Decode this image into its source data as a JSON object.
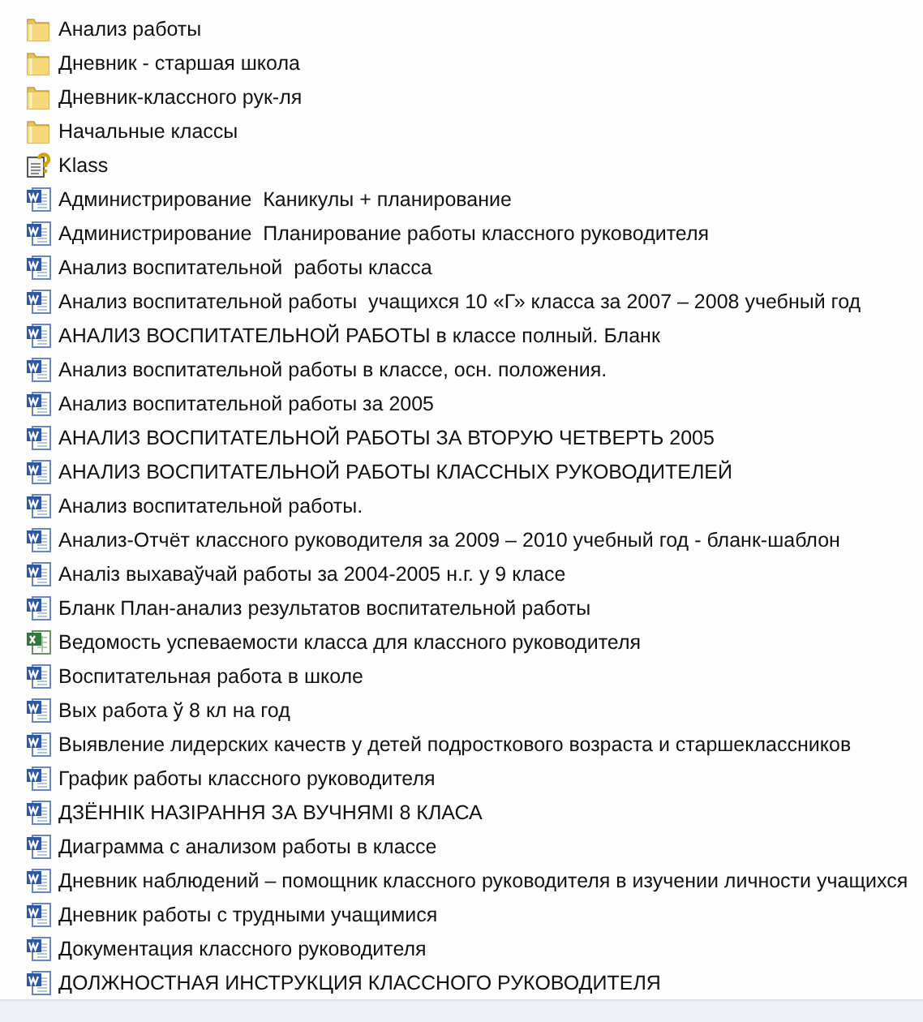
{
  "files": [
    {
      "kind": "folder",
      "name": "Анализ работы"
    },
    {
      "kind": "folder",
      "name": "Дневник - старшая школа"
    },
    {
      "kind": "folder",
      "name": "Дневник-классного рук-ля"
    },
    {
      "kind": "folder",
      "name": "Начальные классы"
    },
    {
      "kind": "unknown",
      "name": "Klass"
    },
    {
      "kind": "word",
      "name": "Администрирование  Каникулы + планирование"
    },
    {
      "kind": "word",
      "name": "Администрирование  Планирование работы классного руководителя"
    },
    {
      "kind": "word",
      "name": "Анализ воспитательной  работы класса"
    },
    {
      "kind": "word",
      "name": "Анализ воспитательной работы  учащихся 10 «Г» класса за 2007 – 2008 учебный год"
    },
    {
      "kind": "word",
      "name": "АНАЛИЗ ВОСПИТАТЕЛЬНОЙ РАБОТЫ в классе полный. Бланк"
    },
    {
      "kind": "word",
      "name": "Анализ воспитательной работы в классе, осн. положения."
    },
    {
      "kind": "word",
      "name": "Анализ воспитательной работы за 2005"
    },
    {
      "kind": "word",
      "name": "АНАЛИЗ ВОСПИТАТЕЛЬНОЙ РАБОТЫ ЗА ВТОРУЮ ЧЕТВЕРТЬ 2005"
    },
    {
      "kind": "word",
      "name": "АНАЛИЗ ВОСПИТАТЕЛЬНОЙ РАБОТЫ КЛАССНЫХ РУКОВОДИТЕЛЕЙ"
    },
    {
      "kind": "word",
      "name": "Анализ воспитательной работы."
    },
    {
      "kind": "word",
      "name": "Анализ-Отчёт классного руководителя за 2009 – 2010 учебный год - бланк-шаблон"
    },
    {
      "kind": "word",
      "name": "Аналіз выхаваўчай работы за 2004-2005 н.г. у 9 класе"
    },
    {
      "kind": "word",
      "name": "Бланк План-анализ результатов воспитательной работы"
    },
    {
      "kind": "excel",
      "name": "Ведомость успеваемости класса для классного руководителя"
    },
    {
      "kind": "word",
      "name": "Воспитательная работа в школе"
    },
    {
      "kind": "word",
      "name": "Вых работа ў 8 кл на год"
    },
    {
      "kind": "word",
      "name": "Выявление лидерских качеств у детей подросткового возраста и старшеклассников"
    },
    {
      "kind": "word",
      "name": "График работы классного руководителя"
    },
    {
      "kind": "word",
      "name": "ДЗЁННІК НАЗІРАННЯ ЗА ВУЧНЯМІ 8 КЛАСА"
    },
    {
      "kind": "word",
      "name": "Диаграмма с анализом работы в классе"
    },
    {
      "kind": "word",
      "name": "Дневник наблюдений – помощник классного руководителя в изучении личности учащихся"
    },
    {
      "kind": "word",
      "name": "Дневник работы с трудными учащимися"
    },
    {
      "kind": "word",
      "name": "Документация классного руководителя"
    },
    {
      "kind": "word",
      "name": "ДОЛЖНОСТНАЯ ИНСТРУКЦИЯ КЛАССНОГО РУКОВОДИТЕЛЯ"
    }
  ]
}
